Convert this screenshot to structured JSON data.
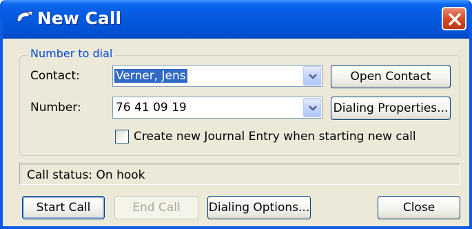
{
  "window": {
    "title": "New Call",
    "titlebar_color": "#0458dc",
    "icon": "phone-handset-icon"
  },
  "group": {
    "label": "Number to dial",
    "contact": {
      "label": "Contact:",
      "value": "Verner, Jens"
    },
    "number": {
      "label": "Number:",
      "value": "76 41 09 19"
    },
    "open_contact_label": "Open Contact",
    "dialing_properties_label": "Dialing Properties...",
    "journal_checkbox": {
      "label": "Create new Journal Entry when starting new call",
      "checked": false
    }
  },
  "status": {
    "text": "Call status: On hook"
  },
  "buttons": {
    "start_call": "Start Call",
    "end_call": "End Call",
    "dialing_options": "Dialing Options...",
    "close": "Close"
  }
}
